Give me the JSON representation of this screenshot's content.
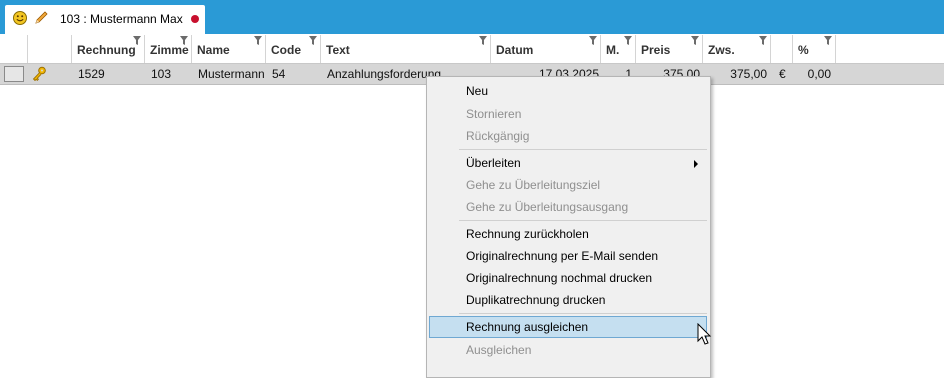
{
  "tab": {
    "label": "103 :  Mustermann Max"
  },
  "columns": [
    "Rechnung",
    "Zimme",
    "Name",
    "Code",
    "Text",
    "Datum",
    "M.",
    "Preis",
    "Zws.",
    "",
    "%"
  ],
  "row": {
    "rechnung": "1529",
    "zimmer": "103",
    "name": "Mustermann",
    "code": "54",
    "text": "Anzahlungsforderung",
    "datum": "17.03.2025",
    "m": "1",
    "preis": "375,00",
    "zws": "375,00",
    "currency": "€",
    "pct": "0,00"
  },
  "menu": {
    "neu": "Neu",
    "stornieren": "Stornieren",
    "rueckgaengig": "Rückgängig",
    "ueberleiten": "Überleiten",
    "gehe_ziel": "Gehe zu Überleitungsziel",
    "gehe_ausgang": "Gehe zu Überleitungsausgang",
    "zurueckholen": "Rechnung zurückholen",
    "email": "Originalrechnung per E-Mail senden",
    "nochmal": "Originalrechnung nochmal drucken",
    "duplikat": "Duplikatrechnung drucken",
    "ausgleichen_rechnung": "Rechnung ausgleichen",
    "ausgleichen": "Ausgleichen"
  },
  "colors": {
    "titlebar": "#2a9ad6",
    "highlight": "#c5dff0",
    "status_dot": "#c8102e"
  },
  "icons": [
    "smiley-icon",
    "pencil-icon",
    "filter-icon",
    "key-icon",
    "submenu-arrow-icon",
    "mouse-cursor-icon"
  ]
}
